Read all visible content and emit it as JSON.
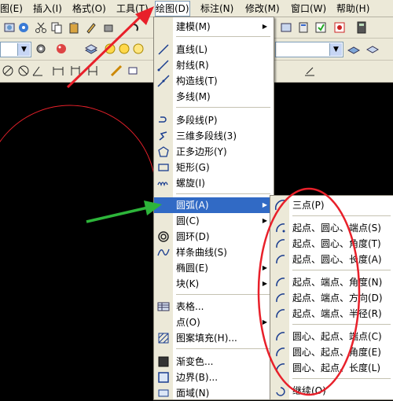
{
  "menubar": {
    "items": [
      {
        "label": "图(E)"
      },
      {
        "label": "插入(I)"
      },
      {
        "label": "格式(O)"
      },
      {
        "label": "工具(T)"
      },
      {
        "label": "绘图(D)"
      },
      {
        "label": "标注(N)"
      },
      {
        "label": "修改(M)"
      },
      {
        "label": "窗口(W)"
      },
      {
        "label": "帮助(H)"
      }
    ]
  },
  "draw_menu": {
    "items": [
      {
        "label": "建模(M)",
        "icon": "none",
        "submenu": true
      },
      {
        "label": "直线(L)",
        "icon": "line-icon"
      },
      {
        "label": "射线(R)",
        "icon": "ray-icon"
      },
      {
        "label": "构造线(T)",
        "icon": "construction-line-icon"
      },
      {
        "label": "多线(M)",
        "icon": "none"
      },
      {
        "label": "多段线(P)",
        "icon": "polyline-icon"
      },
      {
        "label": "三维多段线(3)",
        "icon": "3d-polyline-icon"
      },
      {
        "label": "正多边形(Y)",
        "icon": "polygon-icon"
      },
      {
        "label": "矩形(G)",
        "icon": "rectangle-icon"
      },
      {
        "label": "螺旋(I)",
        "icon": "helix-icon"
      },
      {
        "label": "圆弧(A)",
        "icon": "none",
        "submenu": true
      },
      {
        "label": "圆(C)",
        "icon": "none",
        "submenu": true
      },
      {
        "label": "圆环(D)",
        "icon": "donut-icon"
      },
      {
        "label": "样条曲线(S)",
        "icon": "spline-icon"
      },
      {
        "label": "椭圆(E)",
        "icon": "none",
        "submenu": true
      },
      {
        "label": "块(K)",
        "icon": "none",
        "submenu": true
      },
      {
        "label": "表格...",
        "icon": "table-icon"
      },
      {
        "label": "点(O)",
        "icon": "none",
        "submenu": true
      },
      {
        "label": "图案填充(H)...",
        "icon": "hatch-icon"
      },
      {
        "label": "渐变色...",
        "icon": "gradient-icon"
      },
      {
        "label": "边界(B)...",
        "icon": "boundary-icon"
      },
      {
        "label": "面域(N)",
        "icon": "region-icon"
      }
    ]
  },
  "arc_submenu": {
    "items": [
      {
        "label": "三点(P)"
      },
      {
        "label": "起点、圆心、端点(S)"
      },
      {
        "label": "起点、圆心、角度(T)"
      },
      {
        "label": "起点、圆心、长度(A)"
      },
      {
        "label": "起点、端点、角度(N)"
      },
      {
        "label": "起点、端点、方向(D)"
      },
      {
        "label": "起点、端点、半径(R)"
      },
      {
        "label": "圆心、起点、端点(C)"
      },
      {
        "label": "圆心、起点、角度(E)"
      },
      {
        "label": "圆心、起点、长度(L)"
      },
      {
        "label": "继续(O)"
      }
    ]
  },
  "colors": {
    "highlight": "#316ac5",
    "annotation_red": "#e8202a",
    "annotation_green": "#2db53a",
    "canvas": "#000000"
  }
}
